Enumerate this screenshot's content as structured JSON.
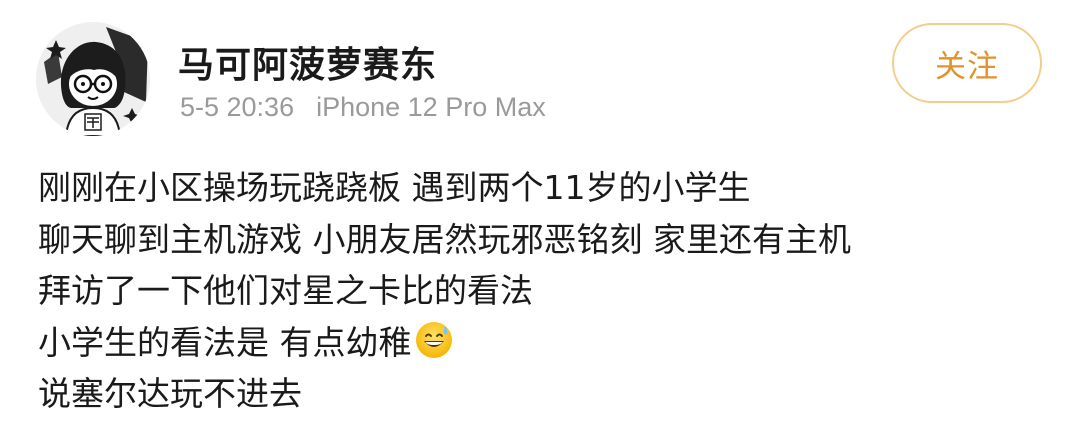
{
  "post": {
    "author": "马可阿菠萝赛东",
    "date": "5-5 20:36",
    "device": "iPhone 12 Pro Max",
    "follow_label": "关注",
    "lines": [
      "刚刚在小区操场玩跷跷板 遇到两个11岁的小学生",
      "聊天聊到主机游戏 小朋友居然玩邪恶铭刻 家里还有主机",
      "拜访了一下他们对星之卡比的看法",
      "小学生的看法是 有点幼稚",
      "说塞尔达玩不进去"
    ],
    "emoji": "grinning-face-with-sweat-icon",
    "avatar_icon": "avatar-girl-with-glasses-icon"
  },
  "colors": {
    "follow_text": "#e2922b",
    "follow_border": "#f3cd8b",
    "meta_text": "#9a9a9a",
    "body_text": "#1a1a1a"
  }
}
